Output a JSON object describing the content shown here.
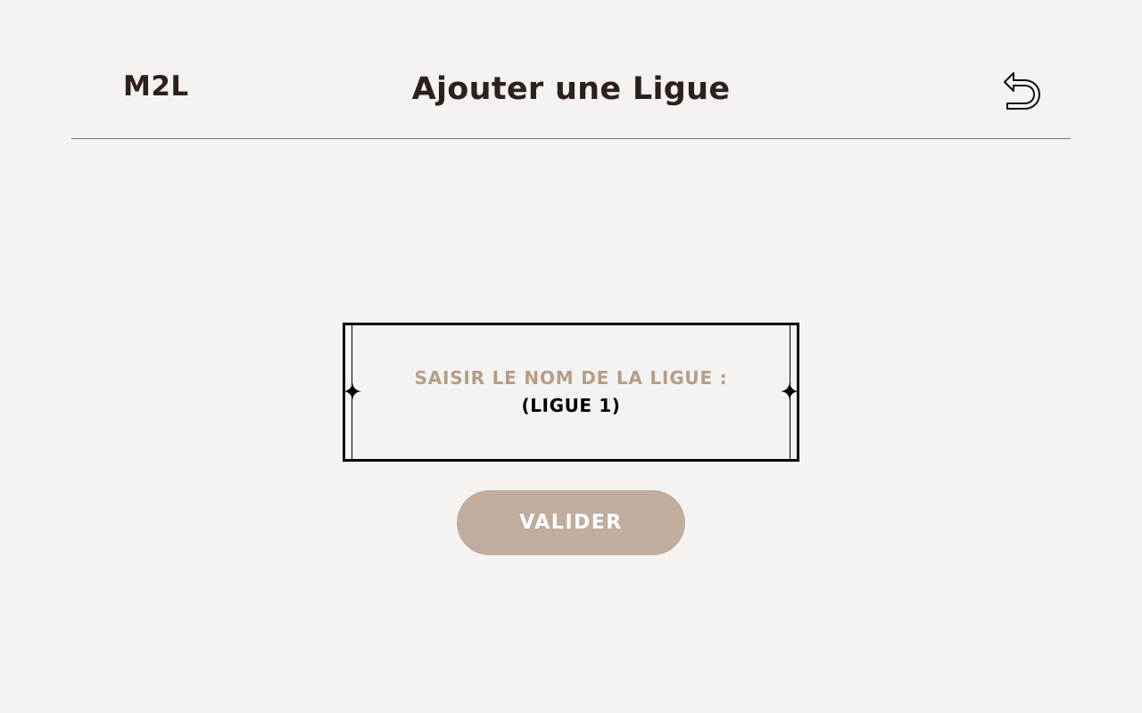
{
  "header": {
    "logo": "M2L",
    "title": "Ajouter une Ligue",
    "back_icon": "undo-arrow-icon"
  },
  "form": {
    "label": "SAISIR LE NOM DE LA LIGUE :",
    "placeholder": "(LIGUE 1)",
    "submit_label": "VALIDER"
  },
  "colors": {
    "background": "#f4f3f1",
    "text_dark": "#2e211d",
    "label_accent": "#b59e88",
    "button_bg": "#c0ad9d"
  }
}
